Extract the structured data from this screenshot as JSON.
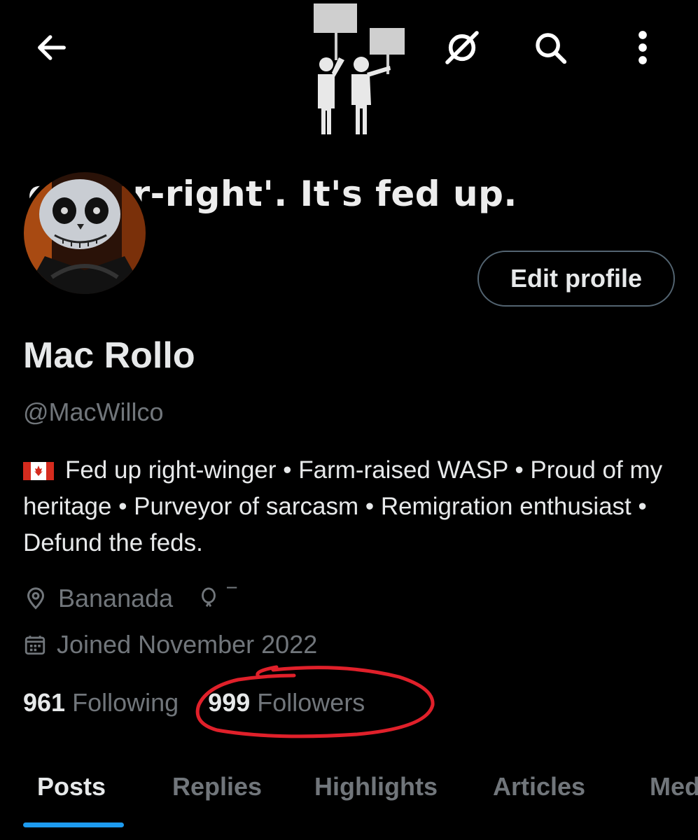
{
  "banner": {
    "text": "ot 'far-right'. It's fed up."
  },
  "topbar": {
    "back_icon": "arrow-left-icon",
    "grok_icon": "grok-icon",
    "search_icon": "search-icon",
    "more_icon": "more-vertical-icon"
  },
  "profile": {
    "edit_label": "Edit profile",
    "name": "Mac Rollo",
    "handle": "@MacWillco",
    "bio_flag": "canada-flag-icon",
    "bio": "Fed up right-winger • Farm-raised WASP • Proud of my heritage • Purveyor of sarcasm • Remigration enthusiast • Defund the feds.",
    "location": "Bananada",
    "location_extra": "‾",
    "joined": "Joined November 2022",
    "following_count": "961",
    "following_label": "Following",
    "followers_count": "999",
    "followers_label": "Followers"
  },
  "tabs": [
    "Posts",
    "Replies",
    "Highlights",
    "Articles",
    "Media"
  ],
  "colors": {
    "accent": "#1d9bf0",
    "muted": "#71767b",
    "annotation": "#e0202a"
  }
}
